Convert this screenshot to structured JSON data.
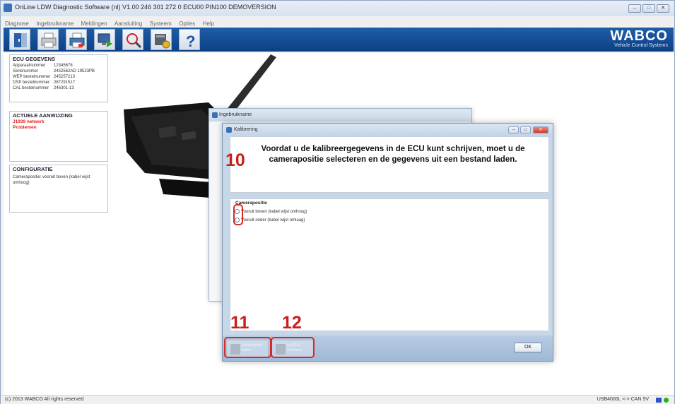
{
  "window": {
    "title": "OnLine LDW Diagnostic Software (nl) V1.00 246 301 272 0 ECU00 PIN100 DEMOVERSION",
    "minimize": "‒",
    "maximize": "□",
    "close": "✕"
  },
  "menu": [
    "Diagnose",
    "Ingebruikname",
    "Meldingen",
    "Aansluiting",
    "Systeem",
    "Opties",
    "Help"
  ],
  "toolbar": {
    "icons": [
      "exit-icon",
      "print-icon",
      "print-report-icon",
      "monitor-run-icon",
      "search-diagnose-icon",
      "ecu-settings-icon",
      "help-icon"
    ],
    "help_label": "?",
    "logo": "WABCO",
    "logo_sub": "Vehicle Control Systems",
    "accent": "#0e4a93"
  },
  "ecu_panel": {
    "title": "ECU GEGEVENS",
    "rows": [
      {
        "k": "Apparaatnummer",
        "v": "12345678"
      },
      {
        "k": "Serienummer",
        "v": "2452562AD 19523PB"
      },
      {
        "k": "WEP bestelnummer",
        "v": "245257213"
      },
      {
        "k": "DSP bestelnummer",
        "v": "287291517"
      },
      {
        "k": "CAL bestelnummer",
        "v": "246301-13"
      }
    ]
  },
  "warning_panel": {
    "title": "ACTUELE AANWIJZING",
    "line1": "J1939 netwerk",
    "line2": "Problemen",
    "color": "#e01a1a"
  },
  "config_panel": {
    "title": "CONFIGURATIE",
    "text": "Camerapositie: vooruit boven (kabel wijst omhoog)"
  },
  "bg_dialog": {
    "title": "Ingebruikname"
  },
  "dialog": {
    "title": "Kalibrering",
    "message": "Voordat u de kalibreergegevens in de ECU kunt schrijven, moet u de camerapositie selecteren en de gegevens uit een bestand laden.",
    "camera_group": "Camerapositie",
    "options": [
      "Vooruit boven (kabel wijst omhoog)",
      "Vooruit onder (kabel wijst omlaag)"
    ],
    "btn_load": "Uit bestand laden",
    "btn_write": "In ECU schrijven",
    "ok": "OK"
  },
  "callouts": [
    "10",
    "11",
    "12"
  ],
  "callout_color": "#c8201b",
  "status": {
    "left": "(c) 2013 WABCO All rights reserved",
    "right": "USB4000L <-> CAN 5V"
  }
}
